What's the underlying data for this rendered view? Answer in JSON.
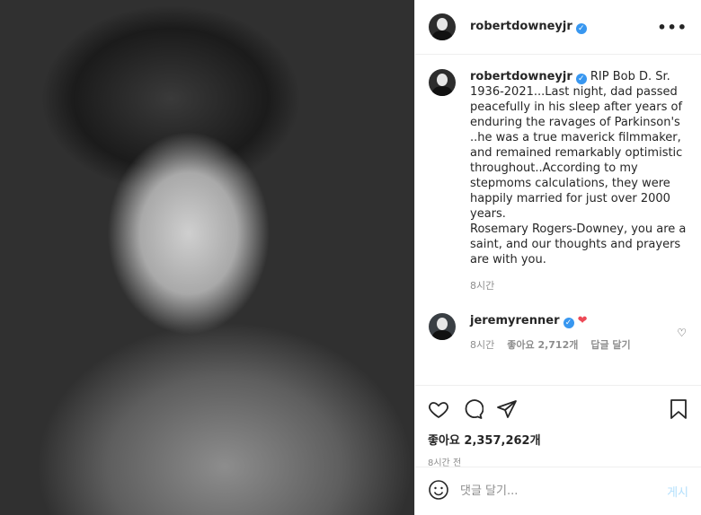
{
  "post": {
    "username": "robertdowneyjr",
    "photo_alt": "Black and white portrait photo"
  },
  "caption": {
    "username": "robertdowneyjr",
    "text": "RIP Bob D. Sr. 1936-2021...Last night, dad passed peacefully in his sleep after years of enduring the ravages of Parkinson's ..he was a true maverick filmmaker, and remained remarkably optimistic throughout..According to my stepmoms calculations, they were happily married for just over 2000 years.\nRosemary Rogers-Downey, you are a saint, and our thoughts and prayers are with you.",
    "time": "8시간"
  },
  "comment": {
    "username": "jeremyrenner",
    "emoji": "❤",
    "time": "8시간",
    "likes": "좋아요 2,712개",
    "reply_label": "답글 달기"
  },
  "actions": {
    "likes": "좋아요 2,357,262개",
    "posted_ago": "8시간 전"
  },
  "add_comment": {
    "placeholder": "댓글 달기...",
    "post_label": "게시"
  },
  "icons": {
    "more": "more-options-icon",
    "verified": "verified-badge-icon",
    "like": "heart-outline-icon",
    "comment": "comment-bubble-icon",
    "share": "paper-plane-icon",
    "save": "bookmark-icon",
    "emoji": "emoji-smile-icon"
  },
  "colors": {
    "verified": "#3897f0",
    "heart": "#ed4956",
    "post_button_disabled": "#b2dffc",
    "muted_text": "#8e8e8e"
  }
}
